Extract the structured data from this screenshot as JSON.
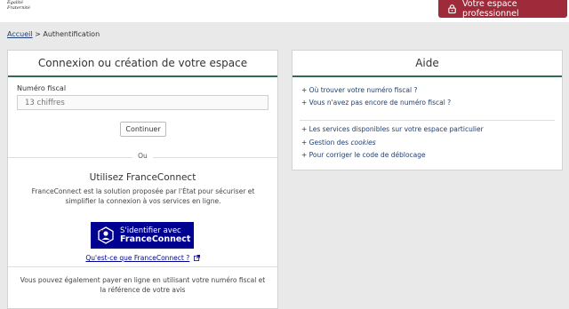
{
  "header": {
    "motto_line1": "Égalité",
    "motto_line2": "Fraternité",
    "pro_button": "Votre espace professionnel"
  },
  "breadcrumb": {
    "home": "Accueil",
    "separator": ">",
    "current": "Authentification"
  },
  "login": {
    "title": "Connexion ou création de votre espace",
    "field_label": "Numéro fiscal",
    "field_placeholder": "13 chiffres",
    "continue": "Continuer",
    "or": "Ou",
    "fc_title": "Utilisez FranceConnect",
    "fc_description": "FranceConnect est la solution proposée par l'État pour sécuriser et simplifier la connexion à vos services en ligne.",
    "fc_button_line1": "S'identifier avec",
    "fc_button_line2": "FranceConnect",
    "fc_link": "Qu'est-ce que FranceConnect ?",
    "pay_text": "Vous pouvez également payer en ligne en utilisant votre numéro fiscal et la référence de votre avis"
  },
  "help": {
    "title": "Aide",
    "link1": "Où trouver votre numéro fiscal ?",
    "link2": "Vous n'avez pas encore de numéro fiscal ?",
    "link3": "Les services disponibles sur votre espace particulier",
    "link4_prefix": "Gestion des ",
    "link4_em": "cookies",
    "link5": "Pour corriger le code de déblocage"
  },
  "colors": {
    "accent_green": "#2e6b4f",
    "pro_button_bg": "#9e2a3a",
    "franceconnect_blue": "#000091",
    "link_blue": "#1f3f73"
  },
  "icons": [
    "lock-icon",
    "franceconnect-logo-icon",
    "external-link-icon"
  ]
}
